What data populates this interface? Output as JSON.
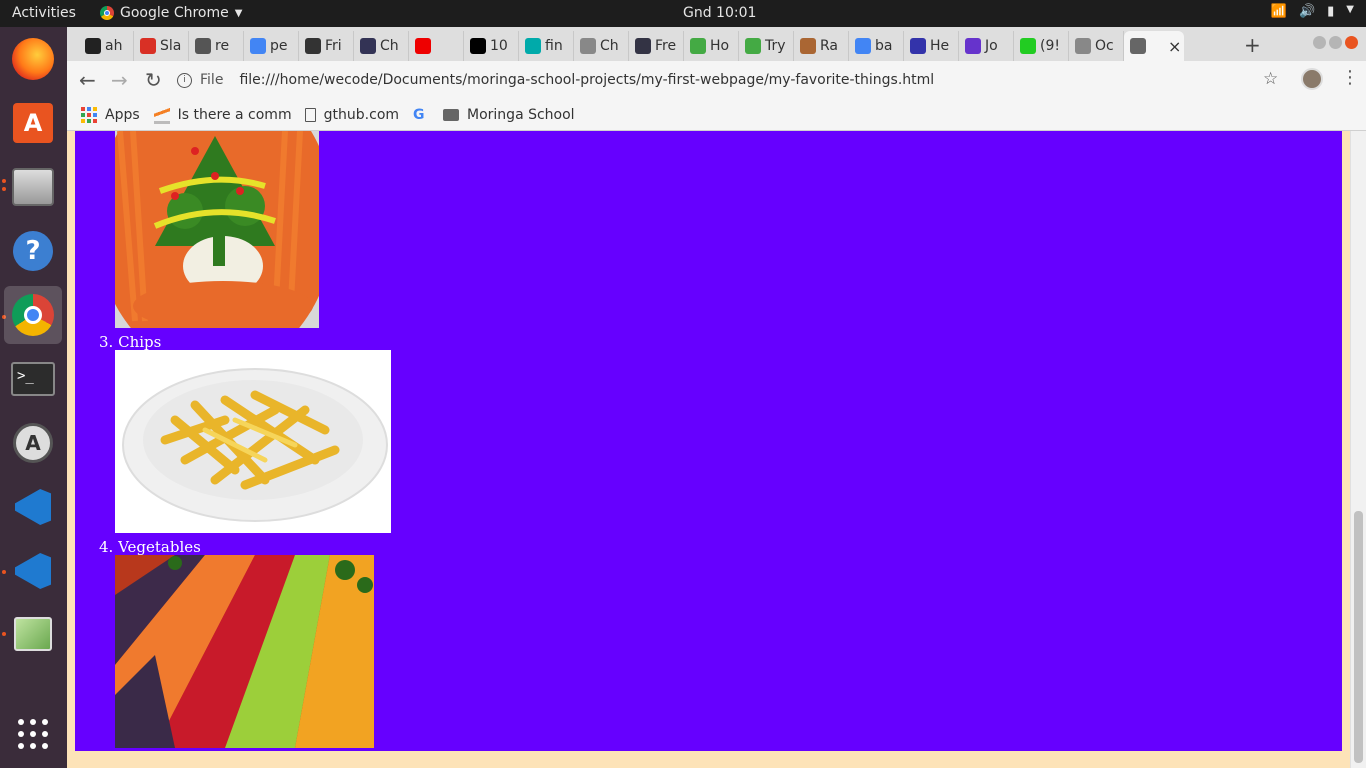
{
  "system": {
    "activities": "Activities",
    "app_name": "Google Chrome",
    "clock": "Gnd 10:01"
  },
  "dock": {
    "items": [
      "firefox-icon",
      "software-center-icon",
      "files-icon",
      "help-icon",
      "chrome-icon",
      "terminal-icon",
      "software-updater-icon",
      "vscode-icon",
      "vscode-insiders-icon",
      "image-viewer-icon",
      "show-apps-icon"
    ]
  },
  "tabs": [
    {
      "label": "ah",
      "icon": "github-icon",
      "color": "#222"
    },
    {
      "label": "Sla",
      "icon": "gmail-icon",
      "color": "#d93025"
    },
    {
      "label": "re",
      "icon": "generic-icon",
      "color": "#555"
    },
    {
      "label": "pe",
      "icon": "google-icon",
      "color": "#4285f4"
    },
    {
      "label": "Fri",
      "icon": "freecodecamp-icon",
      "color": "#333"
    },
    {
      "label": "Ch",
      "icon": "chat-icon",
      "color": "#335"
    },
    {
      "label": "",
      "icon": "youtube-icon",
      "color": "#e00"
    },
    {
      "label": "10",
      "icon": "medium-icon",
      "color": "#000"
    },
    {
      "label": "fin",
      "icon": "m-icon",
      "color": "#0aa"
    },
    {
      "label": "Ch",
      "icon": "doc-icon",
      "color": "#888"
    },
    {
      "label": "Fre",
      "icon": "list-icon",
      "color": "#334"
    },
    {
      "label": "Ho",
      "icon": "codewars-icon",
      "color": "#4a4"
    },
    {
      "label": "Try",
      "icon": "codewars-icon",
      "color": "#4a4"
    },
    {
      "label": "Ra",
      "icon": "cube-icon",
      "color": "#a63"
    },
    {
      "label": "ba",
      "icon": "google-icon",
      "color": "#4285f4"
    },
    {
      "label": "He",
      "icon": "h-icon",
      "color": "#33a"
    },
    {
      "label": "Jo",
      "icon": "ring-icon",
      "color": "#63c"
    },
    {
      "label": "(9!",
      "icon": "whatsapp-icon",
      "color": "#2c2"
    },
    {
      "label": "Oc",
      "icon": "doc-icon",
      "color": "#888"
    },
    {
      "label": "",
      "icon": "page-icon",
      "color": "#666"
    }
  ],
  "toolbar": {
    "scheme_label": "File",
    "url": "file:///home/wecode/Documents/moringa-school-projects/my-first-webpage/my-favorite-things.html"
  },
  "bookmarks": [
    {
      "label": "Apps",
      "icon": "apps-grid-icon"
    },
    {
      "label": "Is there a comma",
      "icon": "stackoverflow-icon"
    },
    {
      "label": "gthub.com",
      "icon": "page-icon"
    },
    {
      "label": "",
      "icon": "google-icon"
    },
    {
      "label": "Moringa School",
      "icon": "folder-icon"
    }
  ],
  "page": {
    "items": [
      {
        "number": "3.",
        "label": "Chips"
      },
      {
        "number": "4.",
        "label": "Vegetables"
      }
    ]
  },
  "colors": {
    "page_bg": "#fde3b8",
    "content_bg": "#6600ff",
    "text": "#ffffff"
  }
}
